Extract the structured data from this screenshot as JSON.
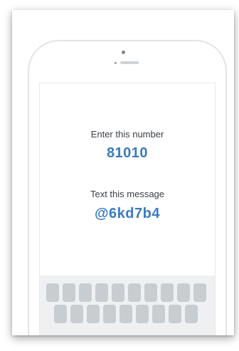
{
  "sms_instructions": {
    "number_label": "Enter this number",
    "number_value": "81010",
    "message_label": "Text this message",
    "message_value": "@6kd7b4"
  },
  "colors": {
    "accent": "#3b7bbf",
    "text": "#3a3f44",
    "keyboard_bg": "#eef0f2",
    "key": "#c8cdd2"
  },
  "icons": [
    "front-camera-icon",
    "speaker-grille-icon"
  ]
}
